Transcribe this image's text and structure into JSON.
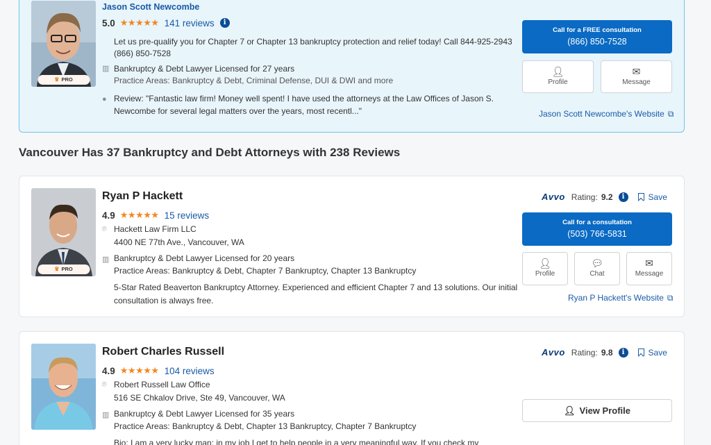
{
  "lawyers": [
    {
      "name": "Jason Scott Newcombe",
      "score": "5.0",
      "stars": "★★★★★",
      "reviews": "141 reviews",
      "pro": "PRO",
      "desc1": "Let us pre-qualify you for Chapter 7 or Chapter 13 bankruptcy protection and relief today! Call 844-925-2943",
      "desc2": "(866) 850-7528",
      "license": "Bankruptcy & Debt Lawyer Licensed for 27 years",
      "practice": "Practice Areas:  Bankruptcy & Debt, Criminal Defense, DUI & DWI and more",
      "review1": "Review:  \"Fantastic law firm! Money well spent! I have used the attorneys at the Law Offices of Jason S.",
      "review2": "Newcombe for several legal matters over the years, most recentl...\"",
      "cta_label": "Call for a FREE consultation",
      "cta_phone": "(866) 850-7528",
      "profile_label": "Profile",
      "message_label": "Message",
      "website": "Jason Scott Newcombe's Website"
    },
    {
      "name": "Ryan P Hackett",
      "score": "4.9",
      "stars": "★★★★★",
      "reviews": "15 reviews",
      "pro": "PRO",
      "firm": "Hackett Law Firm LLC",
      "address": "4400 NE 77th Ave., Vancouver, WA",
      "license": "Bankruptcy & Debt Lawyer Licensed for 20 years",
      "practice": "Practice Areas:  Bankruptcy & Debt, Chapter 7 Bankruptcy, Chapter 13 Bankruptcy",
      "desc1": "5-Star Rated Beaverton Bankruptcy Attorney. Experienced and efficient Chapter 7 and 13 solutions. Our initial",
      "desc2": "consultation is always free.",
      "avvo_brand": "Avvo",
      "rating_label": "Rating:",
      "rating": "9.2",
      "save_label": "Save",
      "cta_label": "Call for a consultation",
      "cta_phone": "(503) 766-5831",
      "profile_label": "Profile",
      "chat_label": "Chat",
      "message_label": "Message",
      "website": "Ryan P Hackett's Website"
    },
    {
      "name": "Robert Charles Russell",
      "score": "4.9",
      "stars": "★★★★★",
      "reviews": "104 reviews",
      "firm": "Robert Russell Law Office",
      "address": "516 SE Chkalov Drive, Ste 49, Vancouver, WA",
      "license": "Bankruptcy & Debt Lawyer Licensed for 35 years",
      "practice": "Practice Areas:  Bankruptcy & Debt, Chapter 13 Bankruptcy, Chapter 7 Bankruptcy",
      "bio": "Bio: I am a very lucky man: in my job I get to help people in a very meaningful way. If you check my",
      "avvo_brand": "Avvo",
      "rating_label": "Rating:",
      "rating": "9.8",
      "save_label": "Save",
      "view_label": "View Profile"
    }
  ],
  "section_title": "Vancouver Has 37 Bankruptcy and Debt Attorneys with 238 Reviews",
  "colors": {
    "primary": "#0a6ac4",
    "star": "#f5861f",
    "link": "#1a5aa6",
    "featured_bg": "#e8f5fb"
  }
}
